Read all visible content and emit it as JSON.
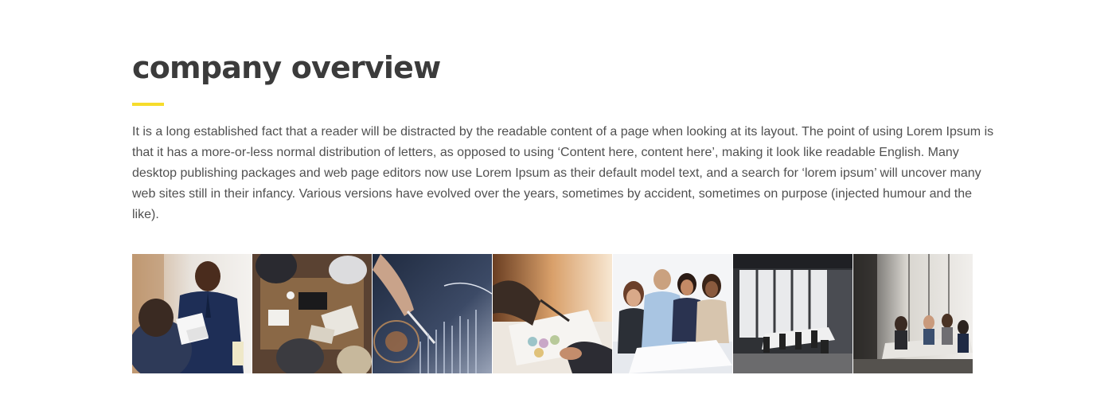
{
  "section": {
    "title": "company overview",
    "body": "It is a long established fact that a reader will be distracted by the readable content of a page when looking at its layout. The point of using Lorem Ipsum is that it has a more-or-less normal distribution of letters, as opposed to using ‘Content here, content here’, making it look like readable English. Many desktop publishing packages and web page editors now use Lorem Ipsum as their default model text, and a search for ‘lorem ipsum’ will uncover many web sites still in their infancy. Various versions have evolved over the years, sometimes by accident, sometimes on purpose (injected humour and the like).",
    "accent_color": "#f6dc2b"
  },
  "gallery": {
    "photos": [
      {
        "name": "businessman-reviewing-documents-photo"
      },
      {
        "name": "team-desk-overhead-photo"
      },
      {
        "name": "hand-with-pen-chart-photo"
      },
      {
        "name": "handshake-over-paperwork-photo"
      },
      {
        "name": "smiling-team-group-photo"
      },
      {
        "name": "empty-conference-room-photo"
      },
      {
        "name": "meeting-room-team-photo"
      }
    ]
  }
}
